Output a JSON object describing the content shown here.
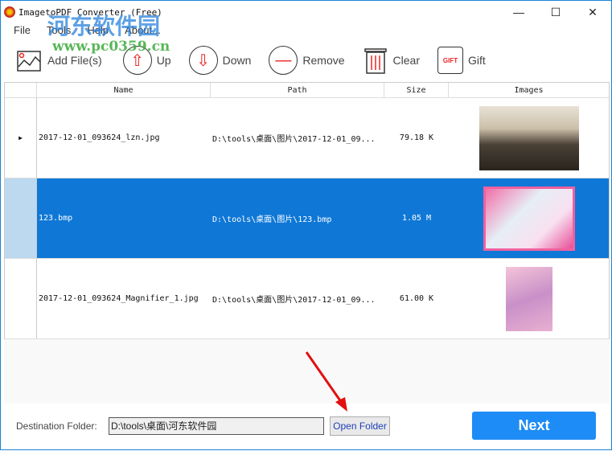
{
  "window": {
    "title": "ImagetoPDF Converter (Free)",
    "minimize": "—",
    "maximize": "☐",
    "close": "✕"
  },
  "menu": [
    "File",
    "Tools",
    "Help",
    "About..."
  ],
  "toolbar": {
    "add": "Add File(s)",
    "up": "Up",
    "down": "Down",
    "remove": "Remove",
    "clear": "Clear",
    "gift": "Gift",
    "gift_badge": "GIFT"
  },
  "table": {
    "headers": [
      "Name",
      "Path",
      "Size",
      "Images"
    ],
    "rows": [
      {
        "name": "2017-12-01_093624_lzn.jpg",
        "path": "D:\\tools\\桌面\\图片\\2017-12-01_09...",
        "size": "79.18 K"
      },
      {
        "name": "123.bmp",
        "path": "D:\\tools\\桌面\\图片\\123.bmp",
        "size": "1.05 M"
      },
      {
        "name": "2017-12-01_093624_Magnifier_1.jpg",
        "path": "D:\\tools\\桌面\\图片\\2017-12-01_09...",
        "size": "61.00 K"
      }
    ],
    "current_marker": "▶"
  },
  "footer": {
    "dest_label": "Destination Folder:",
    "dest_value": "D:\\tools\\桌面\\河东软件园",
    "open_folder": "Open Folder",
    "next": "Next"
  },
  "watermark": {
    "cn": "河东软件园",
    "url": "www.pc0359.cn"
  }
}
